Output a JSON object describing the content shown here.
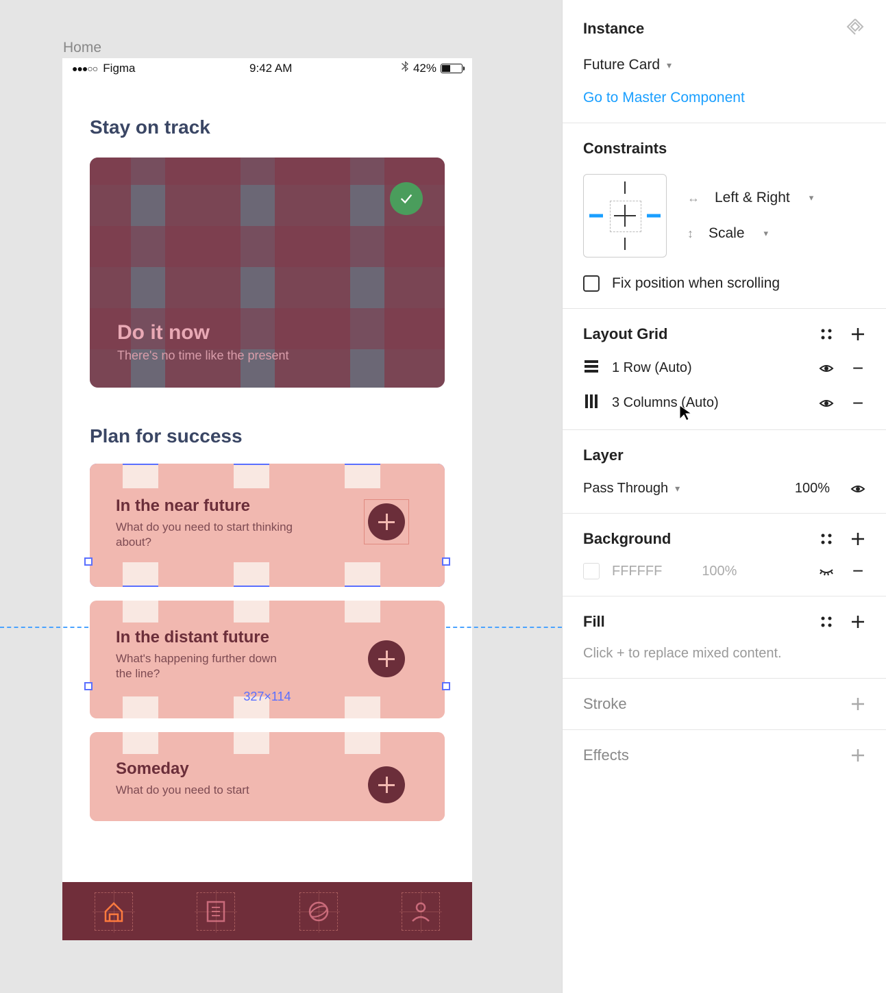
{
  "canvas": {
    "frame_label": "Home",
    "status_bar": {
      "carrier": "Figma",
      "time": "9:42 AM",
      "battery_pct": "42%"
    },
    "sections": {
      "stay_title": "Stay on track",
      "hero": {
        "title": "Do it now",
        "subtitle": "There's no time like the present"
      },
      "plan_title": "Plan for success",
      "future_cards": [
        {
          "title": "In the near future",
          "subtitle": "What do you need to start thinking about?"
        },
        {
          "title": "In the distant future",
          "subtitle": "What's happening further down the line?"
        },
        {
          "title": "Someday",
          "subtitle": "What do you need to start"
        }
      ]
    },
    "selection_dimensions": "327×114"
  },
  "panel": {
    "instance": {
      "title": "Instance",
      "component_name": "Future Card",
      "goto_label": "Go to Master Component"
    },
    "constraints": {
      "title": "Constraints",
      "horizontal": "Left & Right",
      "vertical": "Scale",
      "fix_label": "Fix position when scrolling"
    },
    "layout_grid": {
      "title": "Layout Grid",
      "rows": [
        {
          "label": "1 Row (Auto)"
        },
        {
          "label": "3 Columns (Auto)"
        }
      ]
    },
    "layer": {
      "title": "Layer",
      "blend": "Pass Through",
      "opacity": "100%"
    },
    "background": {
      "title": "Background",
      "hex": "FFFFFF",
      "opacity": "100%"
    },
    "fill": {
      "title": "Fill",
      "hint": "Click + to replace mixed content."
    },
    "stroke": {
      "title": "Stroke"
    },
    "effects": {
      "title": "Effects"
    }
  }
}
